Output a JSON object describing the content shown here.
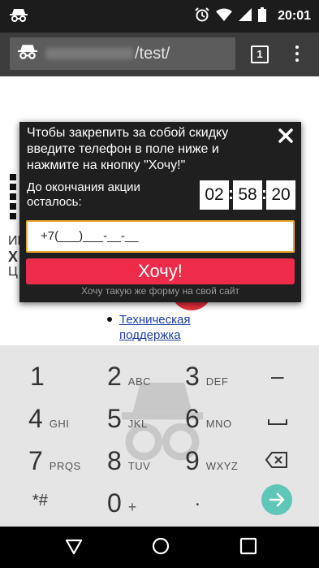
{
  "status_bar": {
    "time": "20:01",
    "icons": [
      "incognito-icon",
      "alarm-icon",
      "wifi-icon",
      "cellular-signal-icon",
      "battery-icon"
    ]
  },
  "browser": {
    "url_path": "/test/",
    "tab_count": "1",
    "icons": [
      "incognito-icon",
      "tab-switcher-icon",
      "overflow-menu-icon"
    ]
  },
  "page": {
    "fragments": [
      "ИН",
      "Х",
      "Ц"
    ],
    "links": [
      "Техническая",
      "поддержка"
    ]
  },
  "popup": {
    "message": "Чтобы закрепить за собой скидку введите телефон в поле ниже и нажмите на кнопку \"Хочу!\"",
    "timer_label": "До окончания акции осталось:",
    "timer": {
      "hours": "02",
      "minutes": "58",
      "seconds": "20"
    },
    "phone_value": "+7(___)___-__-__",
    "submit_label": "Хочу!",
    "footer_link": "Хочу такую же форму на свой сайт",
    "colors": {
      "background": "#1f1f1f",
      "button": "#ee2c4a",
      "input_border": "#f0a830"
    }
  },
  "keypad": {
    "rows": [
      [
        {
          "num": "1",
          "letters": ""
        },
        {
          "num": "2",
          "letters": "ABC"
        },
        {
          "num": "3",
          "letters": "DEF"
        }
      ],
      [
        {
          "num": "4",
          "letters": "GHI"
        },
        {
          "num": "5",
          "letters": "JKL"
        },
        {
          "num": "6",
          "letters": "MNO"
        }
      ],
      [
        {
          "num": "7",
          "letters": "PRQS"
        },
        {
          "num": "8",
          "letters": "TUV"
        },
        {
          "num": "9",
          "letters": "WXYZ"
        }
      ],
      [
        {
          "num": "*#",
          "letters": ""
        },
        {
          "num": "0",
          "letters": "+"
        },
        {
          "num": ".",
          "letters": ""
        }
      ]
    ],
    "minus_label": "–",
    "accent": "#5fc7b7"
  },
  "navbar": {
    "icons": [
      "back-icon",
      "home-icon",
      "recents-icon"
    ]
  }
}
